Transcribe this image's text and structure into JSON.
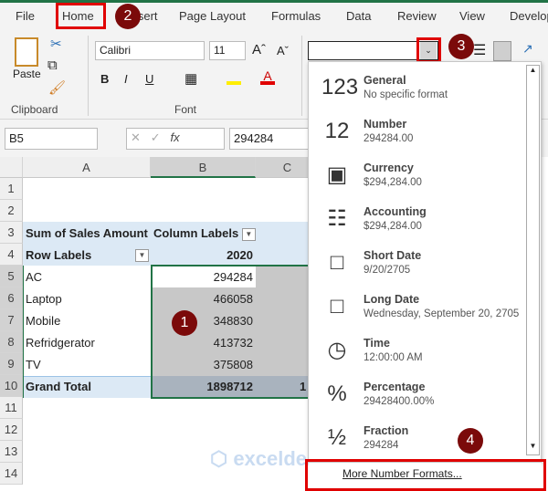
{
  "tabs": [
    "File",
    "Home",
    "Insert",
    "Page Layout",
    "Formulas",
    "Data",
    "Review",
    "View",
    "Develop"
  ],
  "ribbon": {
    "paste": "Paste",
    "clipboard": "Clipboard",
    "font_name": "Calibri",
    "font_size": "11",
    "font": "Font",
    "number_format_value": "",
    "bold": "B",
    "italic": "I",
    "underline": "U",
    "grow": "Aˆ",
    "shrink": "Aˇ"
  },
  "formula_bar": {
    "name_box": "B5",
    "value": "294284",
    "fx": "fx"
  },
  "columns": [
    "A",
    "B",
    "C"
  ],
  "rows": [
    "1",
    "2",
    "3",
    "4",
    "5",
    "6",
    "7",
    "8",
    "9",
    "10",
    "11",
    "12",
    "13",
    "14"
  ],
  "pivot": {
    "header": "Sum of Sales Amount",
    "col_labels": "Column Labels",
    "row_labels": "Row Labels",
    "year": "2020",
    "data": [
      {
        "label": "AC",
        "value": "294284"
      },
      {
        "label": "Laptop",
        "value": "466058"
      },
      {
        "label": "Mobile",
        "value": "348830"
      },
      {
        "label": "Refridgerator",
        "value": "413732"
      },
      {
        "label": "TV",
        "value": "375808"
      }
    ],
    "total_label": "Grand Total",
    "total": "1898712",
    "total_c": "1"
  },
  "menu": {
    "items": [
      {
        "name": "General",
        "example": "No specific format",
        "icon": "123"
      },
      {
        "name": "Number",
        "example": "294284.00",
        "icon": "12"
      },
      {
        "name": "Currency",
        "example": "$294,284.00",
        "icon": "▣"
      },
      {
        "name": "Accounting",
        "example": " $294,284.00",
        "icon": "☷"
      },
      {
        "name": "Short Date",
        "example": "9/20/2705",
        "icon": "□"
      },
      {
        "name": "Long Date",
        "example": "Wednesday, September 20, 2705",
        "icon": "□"
      },
      {
        "name": "Time",
        "example": "12:00:00 AM",
        "icon": "◷"
      },
      {
        "name": "Percentage",
        "example": "29428400.00%",
        "icon": "%"
      },
      {
        "name": "Fraction",
        "example": "294284",
        "icon": "½"
      }
    ],
    "more": "More Number Formats..."
  },
  "badges": [
    "1",
    "2",
    "3",
    "4"
  ],
  "watermark": "exceldemy EXCEL · DATA · BI"
}
